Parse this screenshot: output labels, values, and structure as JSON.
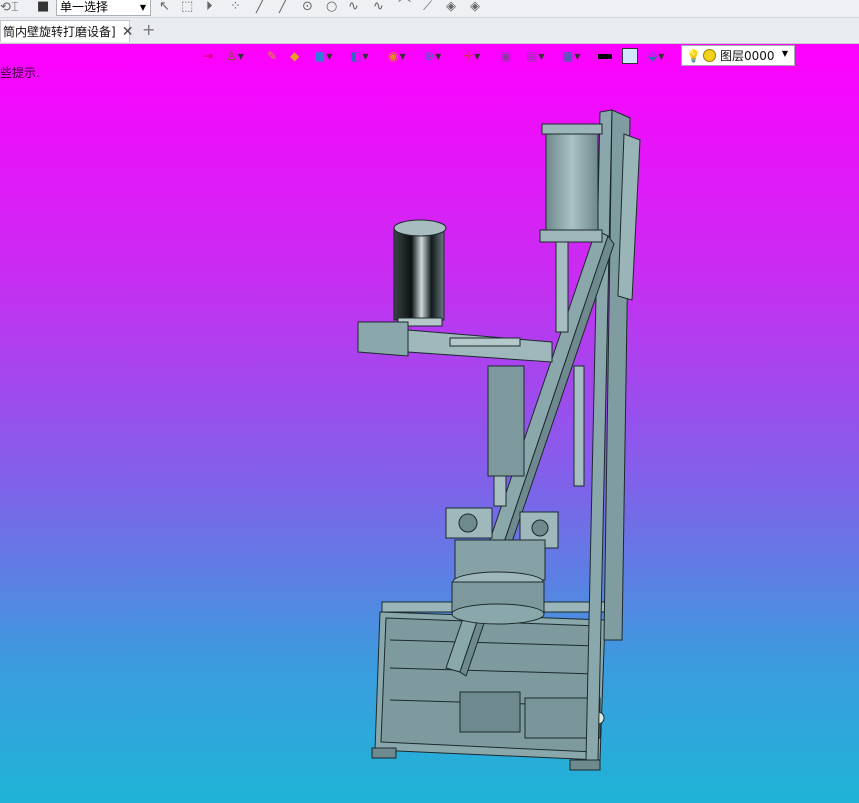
{
  "toolbar": {
    "selection_mode": "单一选择"
  },
  "tabs": [
    {
      "label": "筒内壁旋转打磨设备]"
    }
  ],
  "viewport": {
    "hint_text": "些提示.",
    "background_top": "#ff00ff",
    "background_bottom": "#1fb4d6"
  },
  "view_toolbar": {
    "layer_label": "图层0000",
    "icons": [
      "exit-icon",
      "selector-icon",
      "pen-icon",
      "solid-icon",
      "cube-icon",
      "sections-icon",
      "render-icon",
      "zoom-icon",
      "axis-icon",
      "frame-icon",
      "panel-icon",
      "display-icon",
      "line-color-icon",
      "fill-color-icon",
      "layer-tool-icon"
    ]
  },
  "model": {
    "name": "rotating-grinding-machine",
    "steel_color": "#8aa7ab",
    "edge_color": "#1b2a2c"
  }
}
